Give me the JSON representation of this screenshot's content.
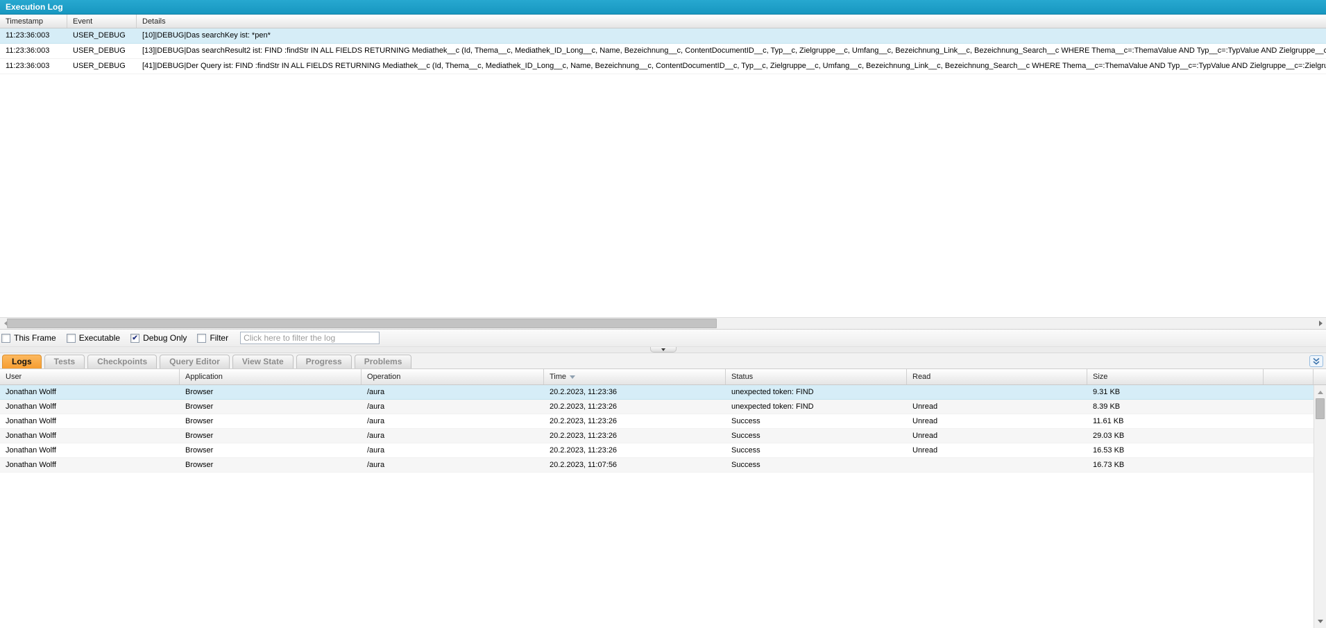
{
  "colors": {
    "titlebar_teal": "#1797c0",
    "active_tab_orange": "#f69d31",
    "selection_blue": "#d6edf7"
  },
  "execution_log": {
    "title": "Execution Log",
    "columns": [
      "Timestamp",
      "Event",
      "Details"
    ],
    "rows": [
      {
        "timestamp": "11:23:36:003",
        "event": "USER_DEBUG",
        "details": "[10]|DEBUG|Das searchKey ist: *pen*",
        "selected": true
      },
      {
        "timestamp": "11:23:36:003",
        "event": "USER_DEBUG",
        "details": "[13]|DEBUG|Das searchResult2 ist: FIND :findStr IN ALL FIELDS RETURNING Mediathek__c (Id, Thema__c, Mediathek_ID_Long__c, Name, Bezeichnung__c, ContentDocumentID__c, Typ__c, Zielgruppe__c, Umfang__c, Bezeichnung_Link__c, Bezeichnung_Search__c WHERE Thema__c=:ThemaValue AND Typ__c=:TypValue AND Zielgruppe__c=:Ziel",
        "selected": false
      },
      {
        "timestamp": "11:23:36:003",
        "event": "USER_DEBUG",
        "details": "[41]|DEBUG|Der Query ist: FIND :findStr IN ALL FIELDS RETURNING Mediathek__c (Id, Thema__c, Mediathek_ID_Long__c, Name, Bezeichnung__c, ContentDocumentID__c, Typ__c, Zielgruppe__c, Umfang__c, Bezeichnung_Link__c, Bezeichnung_Search__c WHERE Thema__c=:ThemaValue AND Typ__c=:TypValue AND Zielgruppe__c=:ZielgruppeV",
        "selected": false
      }
    ]
  },
  "filter_bar": {
    "checkboxes": [
      {
        "label": "This Frame",
        "checked": false
      },
      {
        "label": "Executable",
        "checked": false
      },
      {
        "label": "Debug Only",
        "checked": true
      },
      {
        "label": "Filter",
        "checked": false
      }
    ],
    "input_placeholder": "Click here to filter the log",
    "input_value": ""
  },
  "tabs": {
    "items": [
      {
        "label": "Logs",
        "active": true
      },
      {
        "label": "Tests",
        "active": false
      },
      {
        "label": "Checkpoints",
        "active": false
      },
      {
        "label": "Query Editor",
        "active": false
      },
      {
        "label": "View State",
        "active": false
      },
      {
        "label": "Progress",
        "active": false
      },
      {
        "label": "Problems",
        "active": false
      }
    ]
  },
  "logs_table": {
    "columns": [
      "User",
      "Application",
      "Operation",
      "Time",
      "Status",
      "Read",
      "Size"
    ],
    "sort_column": "Time",
    "sort_direction": "desc",
    "rows": [
      {
        "user": "Jonathan Wolff",
        "application": "Browser",
        "operation": "/aura",
        "time": "20.2.2023, 11:23:36",
        "status": "unexpected token: FIND",
        "read": "",
        "size": "9.31 KB",
        "selected": true
      },
      {
        "user": "Jonathan Wolff",
        "application": "Browser",
        "operation": "/aura",
        "time": "20.2.2023, 11:23:26",
        "status": "unexpected token: FIND",
        "read": "Unread",
        "size": "8.39 KB",
        "selected": false
      },
      {
        "user": "Jonathan Wolff",
        "application": "Browser",
        "operation": "/aura",
        "time": "20.2.2023, 11:23:26",
        "status": "Success",
        "read": "Unread",
        "size": "11.61 KB",
        "selected": false
      },
      {
        "user": "Jonathan Wolff",
        "application": "Browser",
        "operation": "/aura",
        "time": "20.2.2023, 11:23:26",
        "status": "Success",
        "read": "Unread",
        "size": "29.03 KB",
        "selected": false
      },
      {
        "user": "Jonathan Wolff",
        "application": "Browser",
        "operation": "/aura",
        "time": "20.2.2023, 11:23:26",
        "status": "Success",
        "read": "Unread",
        "size": "16.53 KB",
        "selected": false
      },
      {
        "user": "Jonathan Wolff",
        "application": "Browser",
        "operation": "/aura",
        "time": "20.2.2023, 11:07:56",
        "status": "Success",
        "read": "",
        "size": "16.73 KB",
        "selected": false
      }
    ]
  }
}
